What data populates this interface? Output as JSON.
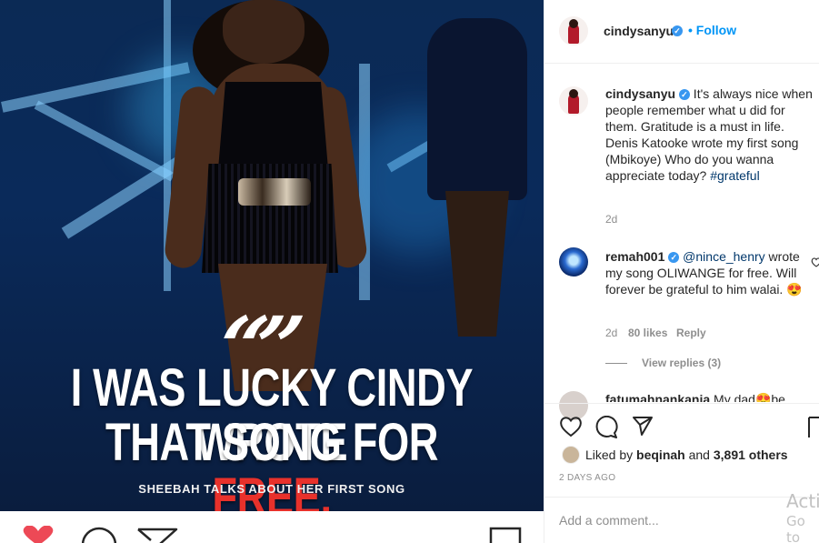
{
  "post_image": {
    "headline_line1": "I WAS LUCKY CINDY WROTE",
    "headline_line2_prefix": "THAT SONG FOR ",
    "headline_line2_highlight": "FREE.",
    "quote_glyph": "“”",
    "subline": "SHEEBAH TALKS ABOUT HER FIRST SONG",
    "highlight_color": "#e8312b"
  },
  "header": {
    "username": "cindysanyu",
    "verified_glyph": "✓",
    "follow_label": "• Follow"
  },
  "caption": {
    "username": "cindysanyu",
    "text": " It's always nice when people remember what u did for them. Gratitude is a must in life. Denis Katooke wrote my first song (Mbikoye) Who do you wanna appreciate today? ",
    "hashtag": "#grateful",
    "time": "2d"
  },
  "comments": [
    {
      "username": "remah001",
      "mention": "@nince_henry",
      "text": " wrote my song OLIWANGE for free. Will forever be grateful to him walai. 😍",
      "time": "2d",
      "likes": "80 likes",
      "reply_label": "Reply",
      "view_replies": "View replies (3)"
    },
    {
      "username": "fatumahnankanja",
      "text": " My dad😍be"
    }
  ],
  "actions": {
    "liked_prefix": "Liked by ",
    "liked_user": "beqinah",
    "liked_and": " and ",
    "liked_count": "3,891 others",
    "time_ago": "2 DAYS AGO",
    "add_comment_placeholder": "Add a comment..."
  },
  "watermark": {
    "line1": "Activ",
    "line2": "Go to"
  },
  "icons": [
    "heart-icon",
    "comment-icon",
    "share-icon",
    "bookmark-icon",
    "verified-icon"
  ],
  "colors": {
    "link_blue": "#0095f6",
    "verified_blue": "#3897f0",
    "muted": "#8e8e8e",
    "heart_red": "#ed4956"
  }
}
